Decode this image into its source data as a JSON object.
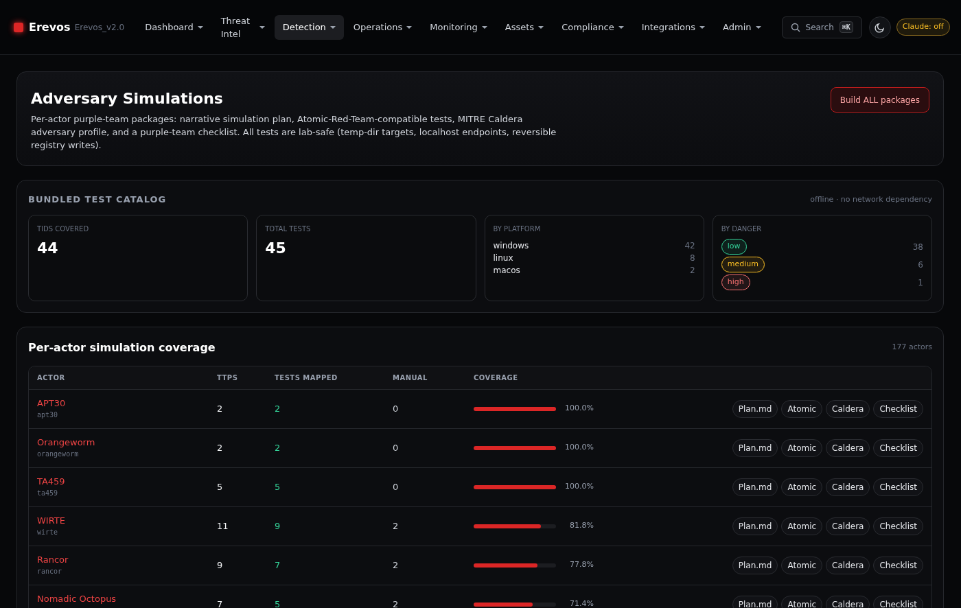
{
  "brand": {
    "name": "Erevos",
    "version": "Erevos_v2.0"
  },
  "nav": [
    {
      "label": "Dashboard",
      "selected": false
    },
    {
      "label": "Threat Intel",
      "selected": false
    },
    {
      "label": "Detection",
      "selected": true
    },
    {
      "label": "Operations",
      "selected": false
    },
    {
      "label": "Monitoring",
      "selected": false
    },
    {
      "label": "Assets",
      "selected": false
    },
    {
      "label": "Compliance",
      "selected": false
    },
    {
      "label": "Integrations",
      "selected": false
    },
    {
      "label": "Admin",
      "selected": false
    }
  ],
  "search": {
    "placeholder": "Search",
    "shortcut": "⌘K"
  },
  "claude_badge": "Claude: off",
  "header": {
    "title": "Adversary Simulations",
    "description": "Per-actor purple-team packages: narrative simulation plan, Atomic-Red-Team-compatible tests, MITRE Caldera adversary profile, and a purple-team checklist. All tests are lab-safe (temp-dir targets, localhost endpoints, reversible registry writes).",
    "button": "Build ALL packages"
  },
  "catalog": {
    "title": "BUNDLED TEST CATALOG",
    "note": "offline · no network dependency",
    "stats": [
      {
        "label": "TIDS COVERED",
        "value": "44"
      },
      {
        "label": "TOTAL TESTS",
        "value": "45"
      }
    ],
    "platform": {
      "label": "BY PLATFORM",
      "items": [
        {
          "name": "windows",
          "count": "42"
        },
        {
          "name": "linux",
          "count": "8"
        },
        {
          "name": "macos",
          "count": "2"
        }
      ]
    },
    "danger": {
      "label": "BY DANGER",
      "items": [
        {
          "name": "low",
          "count": "38",
          "color": "#34d399"
        },
        {
          "name": "medium",
          "count": "6",
          "color": "#fbbf24"
        },
        {
          "name": "high",
          "count": "1",
          "color": "#f87171"
        }
      ]
    }
  },
  "coverage": {
    "title": "Per-actor simulation coverage",
    "count": "177 actors",
    "columns": [
      "ACTOR",
      "TTPS",
      "TESTS MAPPED",
      "MANUAL",
      "COVERAGE"
    ],
    "rows": [
      {
        "actor": "APT30",
        "slug": "apt30",
        "ttps": "2",
        "mapped": "2",
        "manual": "0",
        "level": 1.0,
        "percent": "100.0%",
        "actions": [
          "Plan.md",
          "Atomic",
          "Caldera",
          "Checklist"
        ]
      },
      {
        "actor": "Orangeworm",
        "slug": "orangeworm",
        "ttps": "2",
        "mapped": "2",
        "manual": "0",
        "level": 1.0,
        "percent": "100.0%",
        "actions": [
          "Plan.md",
          "Atomic",
          "Caldera",
          "Checklist"
        ]
      },
      {
        "actor": "TA459",
        "slug": "ta459",
        "ttps": "5",
        "mapped": "5",
        "manual": "0",
        "level": 1.0,
        "percent": "100.0%",
        "actions": [
          "Plan.md",
          "Atomic",
          "Caldera",
          "Checklist"
        ]
      },
      {
        "actor": "WIRTE",
        "slug": "wirte",
        "ttps": "11",
        "mapped": "9",
        "manual": "2",
        "level": 0.818,
        "percent": "81.8%",
        "actions": [
          "Plan.md",
          "Atomic",
          "Caldera",
          "Checklist"
        ]
      },
      {
        "actor": "Rancor",
        "slug": "rancor",
        "ttps": "9",
        "mapped": "7",
        "manual": "2",
        "level": 0.778,
        "percent": "77.8%",
        "actions": [
          "Plan.md",
          "Atomic",
          "Caldera",
          "Checklist"
        ]
      },
      {
        "actor": "Nomadic Octopus",
        "ttps": "7",
        "mapped": "5",
        "manual": "2",
        "level": 0.714,
        "percent": "71.4%",
        "actions": [
          "Plan.md",
          "Atomic",
          "Caldera",
          "Checklist"
        ]
      }
    ]
  }
}
